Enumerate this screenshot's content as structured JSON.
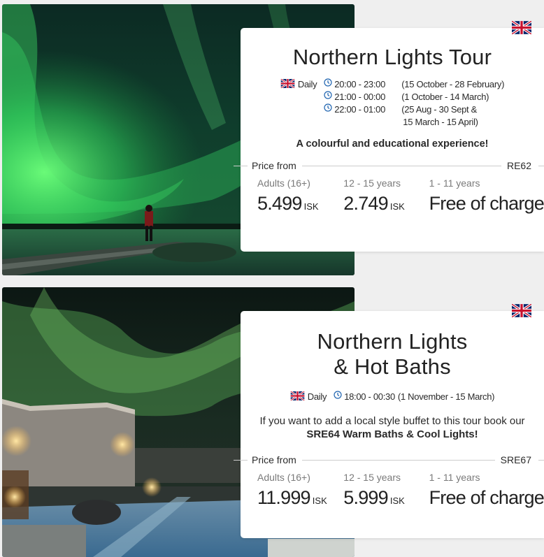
{
  "tours": [
    {
      "title_lines": [
        "Northern Lights Tour"
      ],
      "language_icon": "uk-flag-icon",
      "day": "Daily",
      "times": [
        {
          "range": "20:00 - 23:00",
          "note": "(15 October - 28 February)"
        },
        {
          "range": "21:00 - 00:00",
          "note": "(1 October - 14 March)"
        },
        {
          "range": "22:00 - 01:00",
          "note": "(25 Aug - 30 Sept  &",
          "note2": "15 March - 15 April)"
        }
      ],
      "tagline": "A colourful and educational experience!",
      "price_from_label": "Price from",
      "code": "RE62",
      "prices": [
        {
          "label": "Adults (16+)",
          "amount": "5.499",
          "currency": "ISK"
        },
        {
          "label": "12 - 15 years",
          "amount": "2.749",
          "currency": "ISK"
        },
        {
          "label": "1 - 11 years",
          "amount": "Free of charge",
          "currency": ""
        }
      ]
    },
    {
      "title_lines": [
        "Northern Lights",
        "& Hot Baths"
      ],
      "language_icon": "uk-flag-icon",
      "day": "Daily",
      "times": [
        {
          "range": "18:00 - 00:30",
          "note": "(1 November - 15 March)"
        }
      ],
      "promo_text": "If you want to add a local style buffet to this tour book our ",
      "promo_bold": "SRE64 Warm Baths & Cool Lights!",
      "price_from_label": "Price from",
      "code": "SRE67",
      "prices": [
        {
          "label": "Adults (16+)",
          "amount": "11.999",
          "currency": "ISK"
        },
        {
          "label": "12 - 15 years",
          "amount": "5.999",
          "currency": "ISK"
        },
        {
          "label": "1 - 11 years",
          "amount": "Free of charge",
          "currency": ""
        }
      ]
    }
  ],
  "colors": {
    "page_bg": "#efefef",
    "card_bg": "#ffffff",
    "aurora_green": "#36c256",
    "clock_blue": "#1f64b0"
  }
}
